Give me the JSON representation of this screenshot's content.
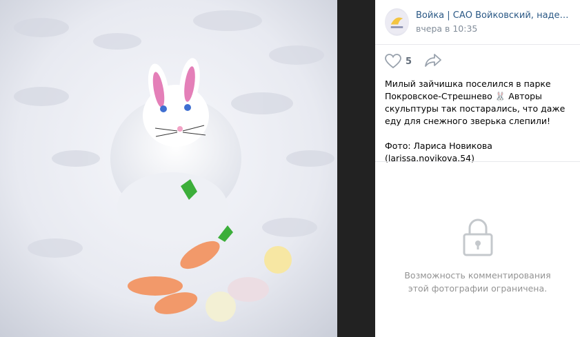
{
  "post": {
    "group_name": "Войка | САО Войковский, надень м...",
    "time": "вчера в 10:35",
    "likes": "5",
    "text": "Милый зайчишка поселился в парке Покровское-Стрешнево 🐰 Авторы скульптуры так постарались, что даже еду для снежного зверька слепили!",
    "credit": "Фото: Лариса Новикова (larissa.novikova.54)"
  },
  "comments": {
    "restricted_text": "Возможность комментирования этой фотографии ограничена."
  },
  "colors": {
    "link": "#2a5885",
    "muted": "#818c99",
    "lock": "#c4c8cc"
  },
  "icons": [
    "heart-icon",
    "share-icon",
    "lock-icon"
  ]
}
